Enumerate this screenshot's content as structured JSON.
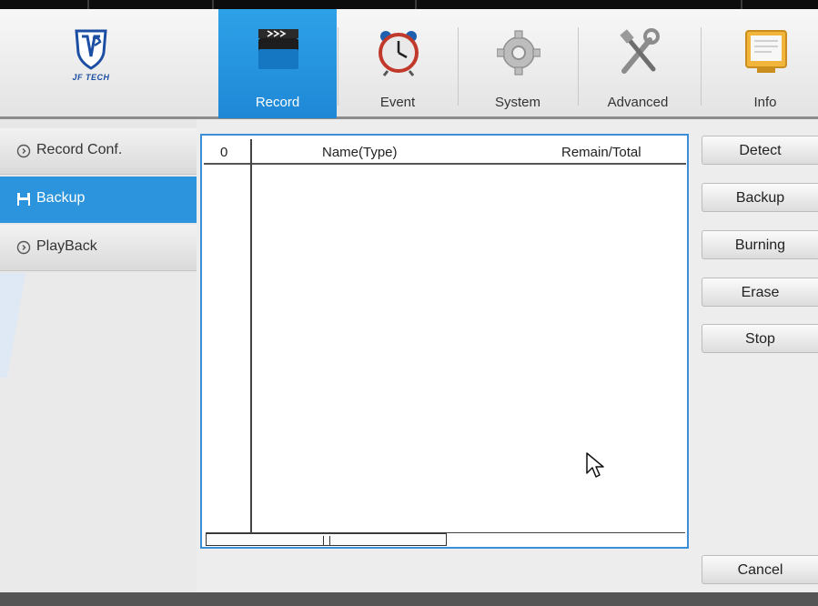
{
  "header": {
    "logo_text": "JF TECH",
    "tabs": [
      {
        "label": "Record",
        "icon": "clapperboard-icon",
        "active": true
      },
      {
        "label": "Event",
        "icon": "alarm-clock-icon",
        "active": false
      },
      {
        "label": "System",
        "icon": "gear-icon",
        "active": false
      },
      {
        "label": "Advanced",
        "icon": "tools-icon",
        "active": false
      },
      {
        "label": "Info",
        "icon": "monitor-icon",
        "active": false
      }
    ]
  },
  "sidebar": {
    "items": [
      {
        "label": "Record Conf.",
        "icon": "circle-arrow-icon",
        "active": false
      },
      {
        "label": "Backup",
        "icon": "save-icon",
        "active": true
      },
      {
        "label": "PlayBack",
        "icon": "circle-arrow-icon",
        "active": false
      }
    ]
  },
  "table": {
    "count": "0",
    "col_name": "Name(Type)",
    "col_remain": "Remain/Total"
  },
  "buttons": {
    "detect": "Detect",
    "backup": "Backup",
    "burning": "Burning",
    "erase": "Erase",
    "stop": "Stop",
    "cancel": "Cancel"
  },
  "colors": {
    "accent": "#2c94dc",
    "table_border": "#3b8fd6"
  }
}
